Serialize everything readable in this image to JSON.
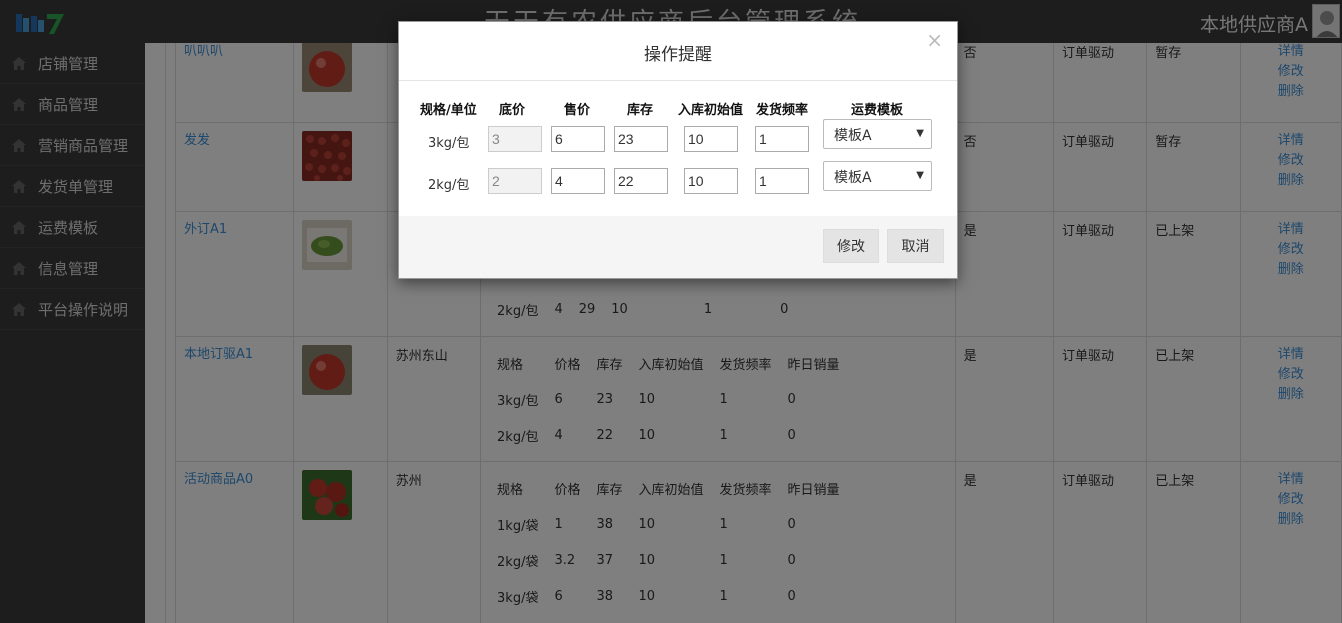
{
  "header": {
    "title": "天天有农供应商后台管理系统",
    "user": "本地供应商A"
  },
  "sidebar": {
    "items": [
      {
        "label": "店铺管理"
      },
      {
        "label": "商品管理"
      },
      {
        "label": "营销商品管理"
      },
      {
        "label": "发货单管理"
      },
      {
        "label": "运费模板"
      },
      {
        "label": "信息管理"
      },
      {
        "label": "平台操作说明"
      }
    ]
  },
  "table": {
    "actions": {
      "detail": "详情",
      "edit": "修改",
      "delete": "删除"
    },
    "rows": [
      {
        "name": "叭叭叭",
        "origin": "",
        "flag": "否",
        "mode": "订单驱动",
        "status": "暂存"
      },
      {
        "name": "发发",
        "origin": "",
        "flag": "否",
        "mode": "订单驱动",
        "status": "暂存"
      },
      {
        "name": "外订A1",
        "origin": "",
        "flag": "是",
        "mode": "订单驱动",
        "status": "已上架",
        "specs": [
          [
            "2kg/包",
            "4",
            "29",
            "10",
            "1",
            "0"
          ]
        ]
      },
      {
        "name": "本地订驱A1",
        "origin": "苏州东山",
        "flag": "是",
        "mode": "订单驱动",
        "status": "已上架",
        "spec_header": [
          "规格",
          "价格",
          "库存",
          "入库初始值",
          "发货频率",
          "昨日销量"
        ],
        "specs": [
          [
            "3kg/包",
            "6",
            "23",
            "10",
            "1",
            "0"
          ],
          [
            "2kg/包",
            "4",
            "22",
            "10",
            "1",
            "0"
          ]
        ]
      },
      {
        "name": "活动商品A0",
        "origin": "苏州",
        "flag": "是",
        "mode": "订单驱动",
        "status": "已上架",
        "spec_header": [
          "规格",
          "价格",
          "库存",
          "入库初始值",
          "发货频率",
          "昨日销量"
        ],
        "specs": [
          [
            "1kg/袋",
            "1",
            "38",
            "10",
            "1",
            "0"
          ],
          [
            "2kg/袋",
            "3.2",
            "37",
            "10",
            "1",
            "0"
          ],
          [
            "3kg/袋",
            "6",
            "38",
            "10",
            "1",
            "0"
          ]
        ]
      }
    ]
  },
  "modal": {
    "title": "操作提醒",
    "close": "×",
    "headers": [
      "规格/单位",
      "底价",
      "售价",
      "库存",
      "入库初始值",
      "发货频率",
      "运费模板"
    ],
    "rows": [
      {
        "unit": "3kg/包",
        "base": "3",
        "price": "6",
        "stock": "23",
        "init": "10",
        "freq": "1",
        "template": "模板A"
      },
      {
        "unit": "2kg/包",
        "base": "2",
        "price": "4",
        "stock": "22",
        "init": "10",
        "freq": "1",
        "template": "模板A"
      }
    ],
    "ok": "修改",
    "cancel": "取消"
  }
}
